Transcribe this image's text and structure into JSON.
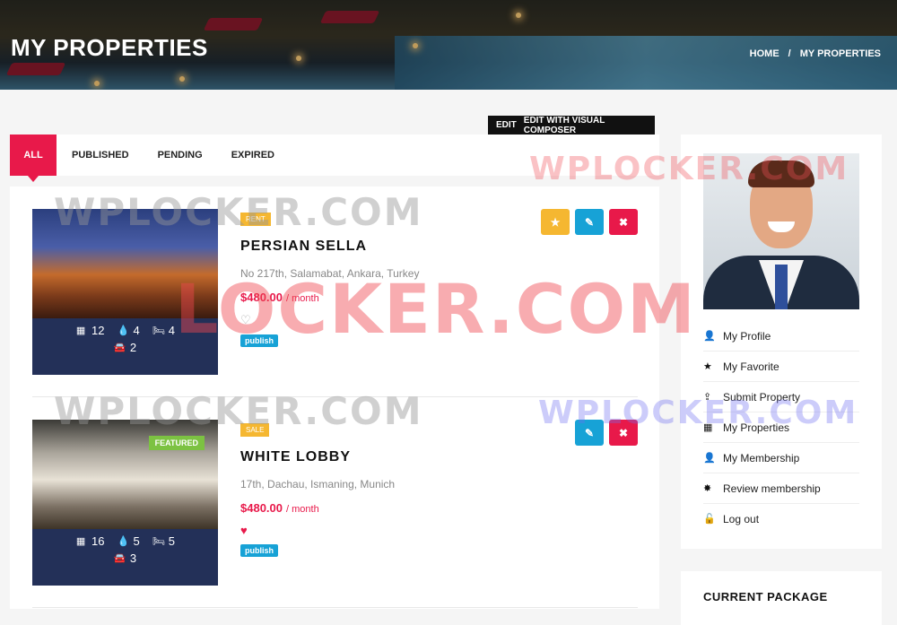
{
  "header": {
    "title": "MY PROPERTIES",
    "breadcrumb": [
      "HOME",
      "/",
      "MY PROPERTIES"
    ]
  },
  "editor_bar": {
    "edit": "EDIT",
    "composer": "EDIT WITH VISUAL COMPOSER"
  },
  "tabs": [
    {
      "label": "ALL",
      "active": true
    },
    {
      "label": "PUBLISHED",
      "active": false
    },
    {
      "label": "PENDING",
      "active": false
    },
    {
      "label": "EXPIRED",
      "active": false
    }
  ],
  "properties": [
    {
      "type_badge": "RENT",
      "title": "PERSIAN SELLA",
      "address": "No 217th, Salamabat, Ankara, Turkey",
      "price": "$480.00",
      "period": "/ month",
      "favorited": false,
      "status": "publish",
      "featured_label": "",
      "stats": {
        "area": "12",
        "bath": "4",
        "bed": "4",
        "garage": "2"
      },
      "actions": [
        "star",
        "edit",
        "delete"
      ]
    },
    {
      "type_badge": "SALE",
      "title": "WHITE LOBBY",
      "address": "17th, Dachau, Ismaning, Munich",
      "price": "$480.00",
      "period": "/ month",
      "favorited": true,
      "status": "publish",
      "featured_label": "FEATURED",
      "stats": {
        "area": "16",
        "bath": "5",
        "bed": "5",
        "garage": "3"
      },
      "actions": [
        "edit",
        "delete"
      ]
    }
  ],
  "sidebar": {
    "menu": [
      {
        "label": "My Profile",
        "icon": "user-icon"
      },
      {
        "label": "My Favorite",
        "icon": "star-icon"
      },
      {
        "label": "Submit Property",
        "icon": "upload-icon"
      },
      {
        "label": "My Properties",
        "icon": "building-icon"
      },
      {
        "label": "My Membership",
        "icon": "user-icon"
      },
      {
        "label": "Review membership",
        "icon": "certificate-icon"
      },
      {
        "label": "Log out",
        "icon": "unlock-icon"
      }
    ],
    "package_title": "CURRENT PACKAGE"
  },
  "watermarks": [
    "WPLOCKER.COM",
    "WPLOCKER.COM",
    "LOCKER.COM",
    "WPLOCKER.COM",
    "WPLOCKER.COM"
  ],
  "colors": {
    "accent": "#e8194a",
    "info": "#17a2d6",
    "warning": "#f5b731",
    "featured": "#7cc242",
    "thumb_panel": "#233058"
  }
}
